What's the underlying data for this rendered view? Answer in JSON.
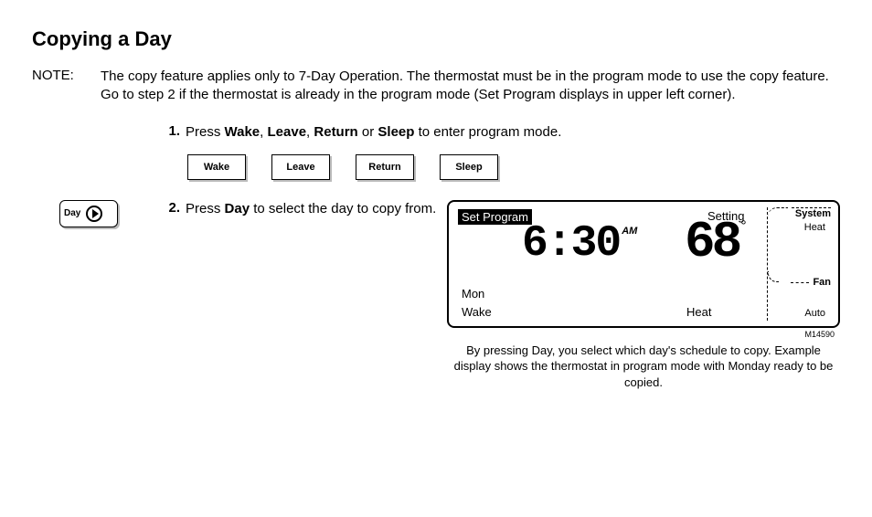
{
  "title": "Copying a Day",
  "note": {
    "label": "NOTE:",
    "text": "The copy feature applies only to 7-Day Operation. The thermostat must be in the program mode to use the copy feature. Go to step 2 if the thermostat is already in the program mode (Set Program displays in upper left corner)."
  },
  "step1": {
    "num": "1.",
    "pre": "Press ",
    "wake": "Wake",
    "c1": ", ",
    "leave": "Leave",
    "c2": ", ",
    "ret": "Return",
    "c3": " or ",
    "sleep": "Sleep",
    "post": " to enter program mode."
  },
  "buttons": {
    "wake": "Wake",
    "leave": "Leave",
    "return": "Return",
    "sleep": "Sleep",
    "day": "Day"
  },
  "step2": {
    "num": "2.",
    "pre": "Press ",
    "day": "Day",
    "post": " to select the day to copy from."
  },
  "lcd": {
    "set_program": "Set Program",
    "setting": "Setting",
    "time": "6:30",
    "ampm": "AM",
    "temp": "68",
    "deg": "°",
    "mon": "Mon",
    "wake": "Wake",
    "heat_bottom": "Heat",
    "system": "System",
    "heat_mode": "Heat",
    "fan": "Fan",
    "auto": "Auto"
  },
  "figure_id": "M14590",
  "caption": "By pressing Day, you select which day's schedule to copy. Example display shows the thermostat in program mode with Monday ready to be copied."
}
